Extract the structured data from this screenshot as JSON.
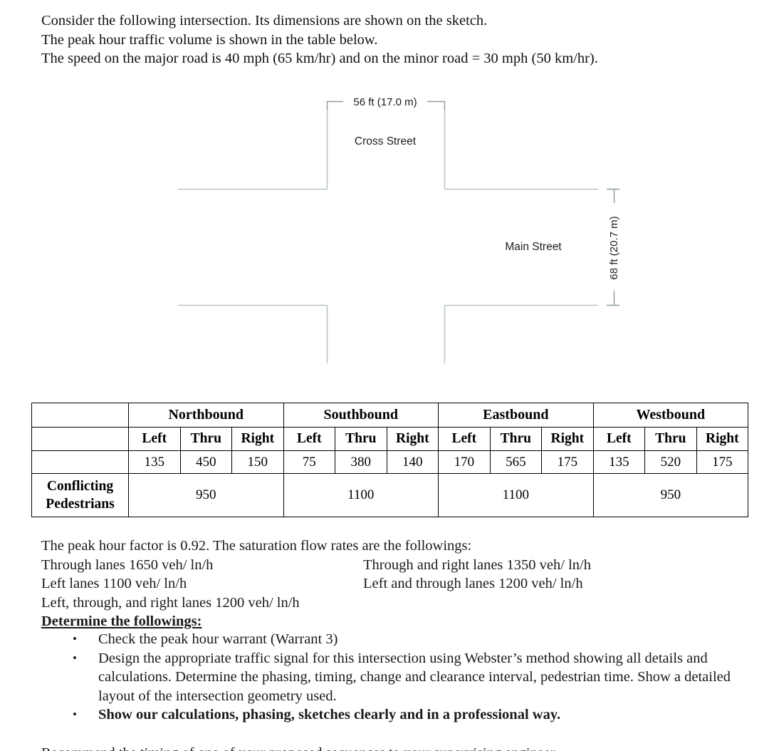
{
  "intro": {
    "lines": [
      "Consider the following intersection. Its dimensions are shown on the sketch.",
      "The peak hour traffic volume is shown in the table below.",
      "The speed on the major road is 40 mph (65 km/hr) and on the minor road = 30 mph (50 km/hr)."
    ]
  },
  "sketch": {
    "horizontal_dimension": "56 ft (17.0 m)",
    "vertical_dimension": "68 ft (20.7 m)",
    "minor_street_label": "Cross Street",
    "major_street_label": "Main Street",
    "line_color": "#b9c5c9"
  },
  "table": {
    "directions": [
      "Northbound",
      "Southbound",
      "Eastbound",
      "Westbound"
    ],
    "movements": [
      "Left",
      "Thru",
      "Right"
    ],
    "volumes": {
      "Northbound": [
        135,
        450,
        150
      ],
      "Southbound": [
        75,
        380,
        140
      ],
      "Eastbound": [
        170,
        565,
        175
      ],
      "Westbound": [
        135,
        520,
        175
      ]
    },
    "ped_row_label_line1": "Conflicting",
    "ped_row_label_line2": "Pedestrians",
    "conflicting_pedestrians": [
      950,
      1100,
      1100,
      950
    ],
    "flat": {
      "nb_left": "135",
      "nb_thru": "450",
      "nb_right": "150",
      "sb_left": "75",
      "sb_thru": "380",
      "sb_right": "140",
      "eb_left": "170",
      "eb_thru": "565",
      "eb_right": "175",
      "wb_left": "135",
      "wb_thru": "520",
      "wb_right": "175",
      "ped_nb": "950",
      "ped_sb": "1100",
      "ped_eb": "1100",
      "ped_wb": "950",
      "dir_nb": "Northbound",
      "dir_sb": "Southbound",
      "dir_eb": "Eastbound",
      "dir_wb": "Westbound",
      "m_left": "Left",
      "m_thru": "Thru",
      "m_right": "Right"
    }
  },
  "saturation": {
    "intro_line": "The peak hour factor is 0.92. The saturation flow rates are the followings:",
    "row1_col1": "Through lanes 1650 veh/ ln/h",
    "row1_col2": "Through and right lanes 1350 veh/ ln/h",
    "row2_col1": "Left lanes 1100 veh/ ln/h",
    "row2_col2": "Left and through lanes 1200 veh/ ln/h",
    "row3_col1": "Left, through, and right lanes 1200 veh/ ln/h",
    "determine_heading": "Determine the followings:"
  },
  "bullets": {
    "marker": "•",
    "items": [
      {
        "text": "Check the peak hour warrant (Warrant 3)",
        "bold": false
      },
      {
        "text": "Design the appropriate traffic signal for this intersection using Webster’s method showing all details and calculations. Determine the phasing, timing, change and clearance interval, pedestrian time. Show a detailed layout of the intersection geometry used.",
        "bold": false
      },
      {
        "text": "Show our calculations, phasing, sketches clearly and in a professional way.",
        "bold": true
      }
    ]
  },
  "cutoff": {
    "text": "Recommend the timing of one of your proposed sequences to your supervising engineer."
  }
}
